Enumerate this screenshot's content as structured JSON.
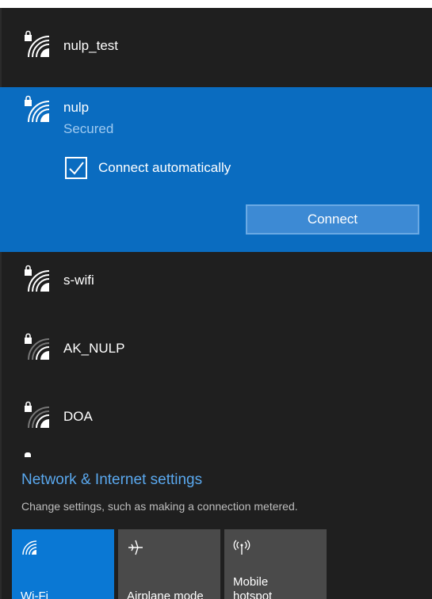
{
  "networks": [
    {
      "ssid": "nulp_test"
    },
    {
      "ssid": "nulp",
      "status": "Secured",
      "connect_auto_label": "Connect automatically",
      "connect_label": "Connect"
    },
    {
      "ssid": "s-wifi"
    },
    {
      "ssid": "AK_NULP"
    },
    {
      "ssid": "DOA"
    }
  ],
  "settings": {
    "title": "Network & Internet settings",
    "subtitle": "Change settings, such as making a connection metered."
  },
  "quick_actions": [
    {
      "label": "Wi-Fi",
      "icon": "wifi-icon",
      "active": true
    },
    {
      "label": "Airplane mode",
      "icon": "airplane-icon",
      "active": false
    },
    {
      "label": "Mobile\nhotspot",
      "icon": "hotspot-icon",
      "active": false
    }
  ],
  "colors": {
    "accent": "#0a78d4",
    "selected": "#0a6cc0",
    "panel": "#1f1f1f",
    "link": "#5aa8ee"
  }
}
